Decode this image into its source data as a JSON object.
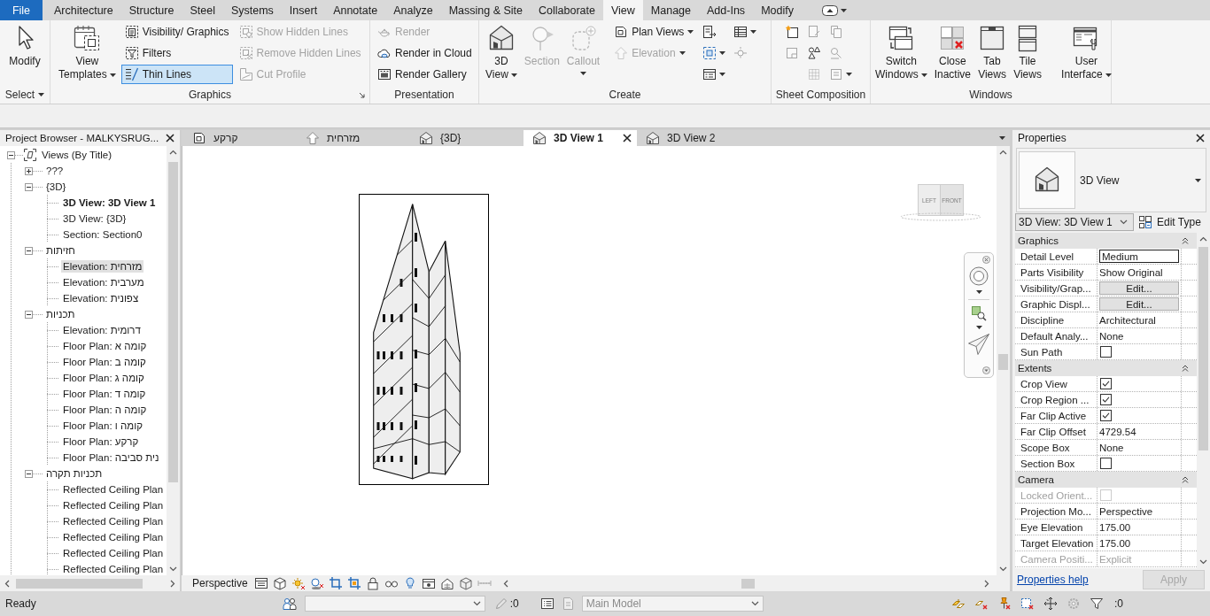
{
  "ribbon_tabs": [
    {
      "label": "File",
      "kind": "file",
      "selected": false
    },
    {
      "label": "Architecture",
      "kind": "tab",
      "selected": false
    },
    {
      "label": "Structure",
      "kind": "tab",
      "selected": false
    },
    {
      "label": "Steel",
      "kind": "tab",
      "selected": false
    },
    {
      "label": "Systems",
      "kind": "tab",
      "selected": false
    },
    {
      "label": "Insert",
      "kind": "tab",
      "selected": false
    },
    {
      "label": "Annotate",
      "kind": "tab",
      "selected": false
    },
    {
      "label": "Analyze",
      "kind": "tab",
      "selected": false
    },
    {
      "label": "Massing & Site",
      "kind": "tab",
      "selected": false
    },
    {
      "label": "Collaborate",
      "kind": "tab",
      "selected": false
    },
    {
      "label": "View",
      "kind": "tab",
      "selected": true
    },
    {
      "label": "Manage",
      "kind": "tab",
      "selected": false
    },
    {
      "label": "Add-Ins",
      "kind": "tab",
      "selected": false
    },
    {
      "label": "Modify",
      "kind": "tab",
      "selected": false
    }
  ],
  "ribbon_panels": [
    {
      "title": "Select",
      "menu": true,
      "launcher": false,
      "columns": [
        {
          "kind": "large",
          "buttons": [
            {
              "lines": [
                "Modify"
              ],
              "disabled": false,
              "dropdown": false
            }
          ]
        }
      ]
    },
    {
      "title": "Graphics",
      "menu": false,
      "launcher": true,
      "columns": [
        {
          "kind": "large",
          "buttons": [
            {
              "lines": [
                "View",
                "Templates"
              ],
              "disabled": false,
              "dropdown": true
            }
          ]
        },
        {
          "kind": "small",
          "buttons": [
            {
              "label": "Visibility/ Graphics",
              "disabled": false,
              "dropdown": false,
              "on": false
            },
            {
              "label": "Filters",
              "disabled": false,
              "dropdown": false,
              "on": false
            },
            {
              "label": "Thin Lines",
              "disabled": false,
              "dropdown": false,
              "on": true
            }
          ]
        },
        {
          "kind": "small",
          "buttons": [
            {
              "label": "Show Hidden Lines",
              "disabled": true,
              "dropdown": false
            },
            {
              "label": "Remove Hidden Lines",
              "disabled": true,
              "dropdown": false
            },
            {
              "label": "Cut Profile",
              "disabled": true,
              "dropdown": false
            }
          ]
        }
      ]
    },
    {
      "title": "Presentation",
      "menu": false,
      "launcher": false,
      "columns": [
        {
          "kind": "small",
          "buttons": [
            {
              "label": "Render",
              "disabled": true,
              "dropdown": false
            },
            {
              "label": "Render in Cloud",
              "disabled": false,
              "dropdown": false
            },
            {
              "label": "Render Gallery",
              "disabled": false,
              "dropdown": false
            }
          ]
        }
      ]
    },
    {
      "title": "Create",
      "menu": false,
      "launcher": false,
      "columns": [
        {
          "kind": "large",
          "buttons": [
            {
              "lines": [
                "3D",
                "View"
              ],
              "disabled": false,
              "dropdown": true
            },
            {
              "lines": [
                "Section"
              ],
              "disabled": true,
              "dropdown": false
            },
            {
              "lines": [
                "Callout"
              ],
              "disabled": true,
              "dropdown": true
            }
          ]
        },
        {
          "kind": "small",
          "buttons": [
            {
              "label": "Plan Views",
              "disabled": false,
              "dropdown": true
            },
            {
              "label": "Elevation",
              "disabled": true,
              "dropdown": true
            }
          ]
        },
        {
          "kind": "icons",
          "buttons": [
            {
              "disabled": false,
              "dropdown": false
            },
            {
              "disabled": false,
              "dropdown": true
            },
            {
              "disabled": false,
              "dropdown": true
            }
          ]
        },
        {
          "kind": "icons",
          "buttons": [
            {
              "disabled": false,
              "dropdown": true
            },
            {
              "disabled": true,
              "dropdown": false
            }
          ]
        }
      ]
    },
    {
      "title": "Sheet Composition",
      "menu": false,
      "launcher": false,
      "columns": [
        {
          "kind": "icons",
          "buttons": [
            {
              "disabled": false,
              "dropdown": false
            },
            {
              "disabled": true,
              "dropdown": false
            }
          ]
        },
        {
          "kind": "icons",
          "buttons": [
            {
              "disabled": true,
              "dropdown": false
            },
            {
              "disabled": false,
              "dropdown": false
            },
            {
              "disabled": true,
              "dropdown": false
            }
          ]
        },
        {
          "kind": "icons",
          "buttons": [
            {
              "disabled": true,
              "dropdown": false
            },
            {
              "disabled": true,
              "dropdown": false
            },
            {
              "disabled": true,
              "dropdown": true
            }
          ]
        }
      ]
    },
    {
      "title": "Windows",
      "menu": false,
      "launcher": false,
      "columns": [
        {
          "kind": "large",
          "buttons": [
            {
              "lines": [
                "Switch",
                "Windows"
              ],
              "disabled": false,
              "dropdown": true
            },
            {
              "lines": [
                "Close",
                "Inactive"
              ],
              "disabled": false,
              "dropdown": false
            },
            {
              "lines": [
                "Tab",
                "Views"
              ],
              "disabled": false,
              "dropdown": false
            },
            {
              "lines": [
                "Tile",
                "Views"
              ],
              "disabled": false,
              "dropdown": false
            }
          ]
        },
        {
          "kind": "separator"
        },
        {
          "kind": "large",
          "buttons": [
            {
              "lines": [
                "User",
                "Interface"
              ],
              "disabled": false,
              "dropdown": true
            }
          ]
        }
      ]
    }
  ],
  "project_browser": {
    "title": "Project Browser - MALKYSRUG...",
    "tree": [
      {
        "label": "Views (By Title)",
        "expanded": true,
        "selected": false,
        "children": [
          {
            "label": "???",
            "expanded": false,
            "selected": false
          },
          {
            "label": "{3D}",
            "expanded": true,
            "selected": false,
            "children": [
              {
                "label": "3D View: 3D View 1",
                "selected": false,
                "current": true
              },
              {
                "label": "3D View: {3D}",
                "selected": false,
                "current": false
              },
              {
                "label": "Section: Section0",
                "selected": false,
                "current": false
              }
            ]
          },
          {
            "label": "חזיתות",
            "expanded": true,
            "selected": false,
            "children": [
              {
                "label": "Elevation: מזרחית",
                "selected": true,
                "current": false
              },
              {
                "label": "Elevation: מערבית",
                "selected": false,
                "current": false
              },
              {
                "label": "Elevation: צפונית",
                "selected": false,
                "current": false
              }
            ]
          },
          {
            "label": "תכניות",
            "expanded": true,
            "selected": false,
            "children": [
              {
                "label": "Elevation: דרומית",
                "selected": false,
                "current": false
              },
              {
                "label": "Floor Plan: קומה א",
                "selected": false,
                "current": false
              },
              {
                "label": "Floor Plan: קומה ב",
                "selected": false,
                "current": false
              },
              {
                "label": "Floor Plan: קומה ג",
                "selected": false,
                "current": false
              },
              {
                "label": "Floor Plan: קומה ד",
                "selected": false,
                "current": false
              },
              {
                "label": "Floor Plan: קומה ה",
                "selected": false,
                "current": false
              },
              {
                "label": "Floor Plan: קומה ו",
                "selected": false,
                "current": false
              },
              {
                "label": "Floor Plan: קרקע",
                "selected": false,
                "current": false
              },
              {
                "label": "Floor Plan: נית סביבה",
                "selected": false,
                "current": false
              }
            ]
          },
          {
            "label": "תכניות תקרה",
            "expanded": true,
            "selected": false,
            "children": [
              {
                "label": "Reflected Ceiling Plan",
                "selected": false,
                "current": false
              },
              {
                "label": "Reflected Ceiling Plan",
                "selected": false,
                "current": false
              },
              {
                "label": "Reflected Ceiling Plan",
                "selected": false,
                "current": false
              },
              {
                "label": "Reflected Ceiling Plan",
                "selected": false,
                "current": false
              },
              {
                "label": "Reflected Ceiling Plan",
                "selected": false,
                "current": false
              },
              {
                "label": "Reflected Ceiling Plan",
                "selected": false,
                "current": false
              }
            ]
          }
        ]
      }
    ]
  },
  "view_tabs": [
    {
      "label": "קרקע",
      "kind": "plan",
      "selected": false
    },
    {
      "label": "מזרחית",
      "kind": "elevation",
      "selected": false
    },
    {
      "label": "{3D}",
      "kind": "model",
      "selected": false
    },
    {
      "label": "3D View 1",
      "kind": "model",
      "selected": true
    },
    {
      "label": "3D View 2",
      "kind": "model",
      "selected": false
    }
  ],
  "view_cube": {
    "faces": [
      "LEFT",
      "FRONT"
    ]
  },
  "view_control_bar": {
    "projection": "Perspective"
  },
  "properties": {
    "title": "Properties",
    "type_name": "3D View",
    "instance": "3D View: 3D View 1",
    "edit_type": "Edit Type",
    "groups": [
      {
        "title": "Graphics",
        "expanded": true,
        "rows": [
          {
            "name": "Detail Level",
            "kind": "field",
            "value": "Medium",
            "disabled": false
          },
          {
            "name": "Parts Visibility",
            "kind": "text",
            "value": "Show Original",
            "disabled": false
          },
          {
            "name": "Visibility/Grap...",
            "kind": "button",
            "value": "Edit...",
            "disabled": false
          },
          {
            "name": "Graphic Displ...",
            "kind": "button",
            "value": "Edit...",
            "disabled": false
          },
          {
            "name": "Discipline",
            "kind": "text",
            "value": "Architectural",
            "disabled": false
          },
          {
            "name": "Default Analy...",
            "kind": "text",
            "value": "None",
            "disabled": false
          },
          {
            "name": "Sun Path",
            "kind": "checkbox",
            "checked": false,
            "disabled": false
          }
        ]
      },
      {
        "title": "Extents",
        "expanded": true,
        "rows": [
          {
            "name": "Crop View",
            "kind": "checkbox",
            "checked": true,
            "disabled": false
          },
          {
            "name": "Crop Region ...",
            "kind": "checkbox",
            "checked": true,
            "disabled": false
          },
          {
            "name": "Far Clip Active",
            "kind": "checkbox",
            "checked": true,
            "disabled": false
          },
          {
            "name": "Far Clip Offset",
            "kind": "text",
            "value": "4729.54",
            "disabled": false
          },
          {
            "name": "Scope Box",
            "kind": "text",
            "value": "None",
            "disabled": false
          },
          {
            "name": "Section Box",
            "kind": "checkbox",
            "checked": false,
            "disabled": false
          }
        ]
      },
      {
        "title": "Camera",
        "expanded": true,
        "rows": [
          {
            "name": "Locked Orient...",
            "kind": "checkbox",
            "checked": false,
            "disabled": true
          },
          {
            "name": "Projection Mo...",
            "kind": "text",
            "value": "Perspective",
            "disabled": false
          },
          {
            "name": "Eye Elevation",
            "kind": "text",
            "value": "175.00",
            "disabled": false
          },
          {
            "name": "Target Elevation",
            "kind": "text",
            "value": "175.00",
            "disabled": false
          },
          {
            "name": "Camera Positi...",
            "kind": "text",
            "value": "Explicit",
            "disabled": true
          }
        ]
      }
    ],
    "help_link": "Properties help",
    "apply": {
      "label": "Apply",
      "disabled": true
    }
  },
  "status_bar": {
    "message": "Ready",
    "workset": {
      "disabled": true
    },
    "editable_count": ":0",
    "design_option": {
      "value": "Main Model",
      "disabled": true
    },
    "filter_count": ":0"
  }
}
